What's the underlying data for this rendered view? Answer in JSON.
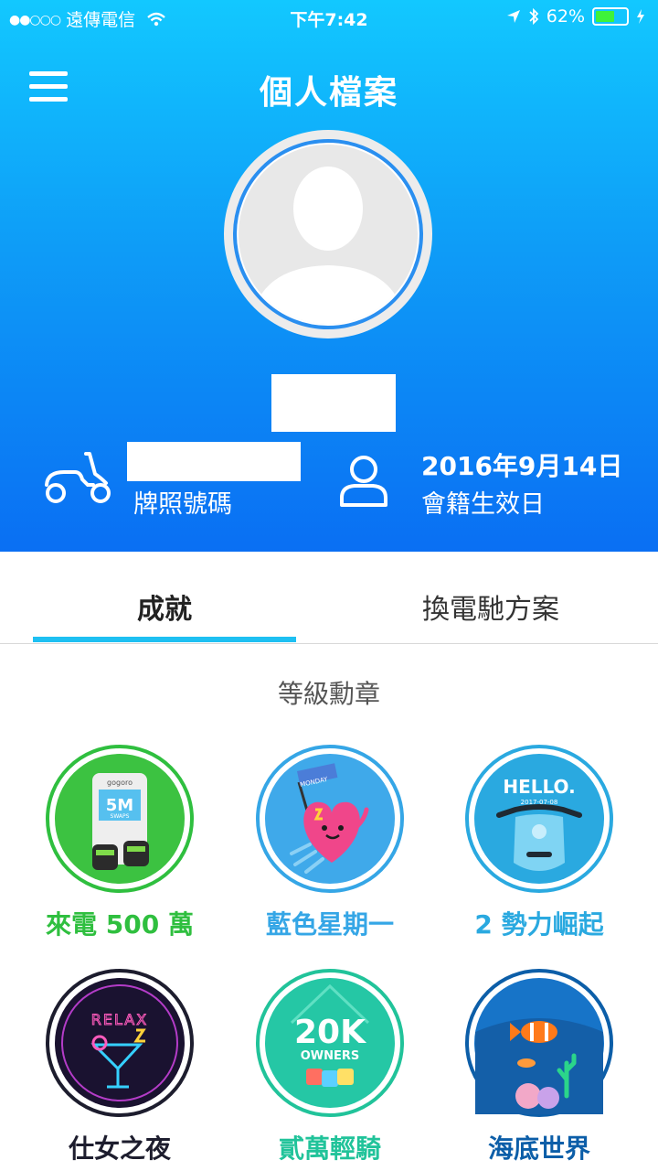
{
  "status_bar": {
    "carrier": "遠傳電信",
    "time": "下午7:42",
    "battery": "62%",
    "battery_level": 0.62
  },
  "header": {
    "title": "個人檔案"
  },
  "profile": {
    "plate_label": "牌照號碼",
    "member_since_date": "2016年9月14日",
    "member_since_label": "會籍生效日"
  },
  "tabs": [
    {
      "label": "成就",
      "active": true
    },
    {
      "label": "換電馳方案",
      "active": false
    }
  ],
  "section": {
    "title": "等級勳章"
  },
  "badges": [
    {
      "label": "來電 500 萬",
      "color": "#2fbf3f"
    },
    {
      "label": "藍色星期一",
      "color": "#35a6e6"
    },
    {
      "label": "2 勢力崛起",
      "color": "#2aa9e0"
    },
    {
      "label": "仕女之夜",
      "color": "#1d1d2e"
    },
    {
      "label": "貳萬輕騎",
      "color": "#21c39a"
    },
    {
      "label": "海底世界",
      "color": "#0c5ea8"
    }
  ],
  "badge_art": {
    "swaps_big": "5M",
    "swaps_small": "SWAPS",
    "brand": "gogoro",
    "monday_flag": "MONDAY",
    "hello_text": "HELLO.",
    "hello_date": "2017-07-08",
    "relax_text": "RELAX",
    "owners_big": "20K",
    "owners_small": "OWNERS"
  }
}
